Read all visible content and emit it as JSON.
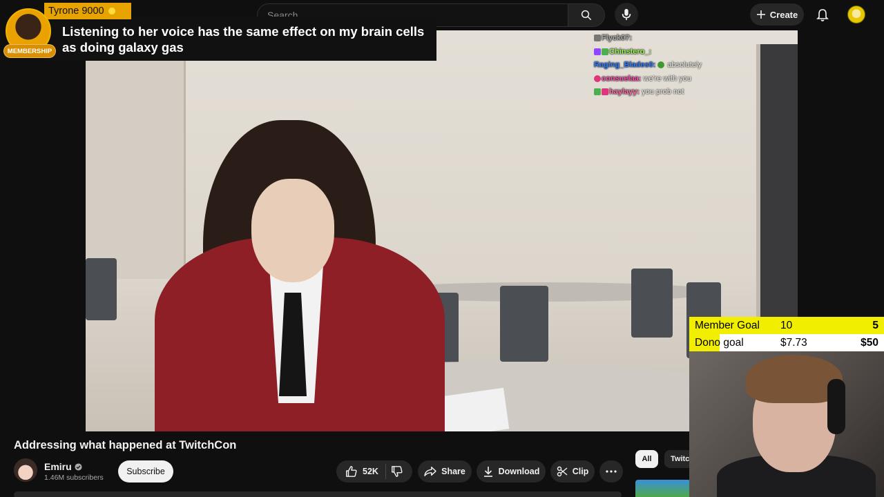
{
  "header": {
    "search_placeholder": "Search",
    "create_label": "Create"
  },
  "video": {
    "chat": [
      {
        "name": "Flyck07:",
        "message": ""
      },
      {
        "name": "Chinstero_:",
        "message": ""
      },
      {
        "name": "Raging_Blades0:",
        "message": "absolutely"
      },
      {
        "name": "consuelaa:",
        "message": "we're with you"
      },
      {
        "name": "haylayy:",
        "message": "you prob not"
      }
    ]
  },
  "membership": {
    "name": "Tyrone 9000",
    "tag": "MEMBERSHIP",
    "message": "Listening to her voice has the same effect on my brain cells as doing galaxy gas"
  },
  "info": {
    "title": "Addressing what happened at TwitchCon",
    "channel": "Emiru",
    "subscribers": "1.46M subscribers",
    "subscribe_label": "Subscribe",
    "likes": "52K",
    "share_label": "Share",
    "download_label": "Download",
    "clip_label": "Clip"
  },
  "sidebar": {
    "chips": [
      "All",
      "Twitch"
    ]
  },
  "goals": [
    {
      "label": "Member Goal",
      "current": "10",
      "target": "5",
      "progress": 1.0
    },
    {
      "label": "Dono goal",
      "current": "$7.73",
      "target": "$50",
      "progress": 0.155
    }
  ],
  "colors": {
    "background": "#0f0f0f",
    "pill": "#272727",
    "membership_gold": "#e7a400",
    "goal_fill": "#f2ee00",
    "jacket_red": "#8e1f26"
  }
}
